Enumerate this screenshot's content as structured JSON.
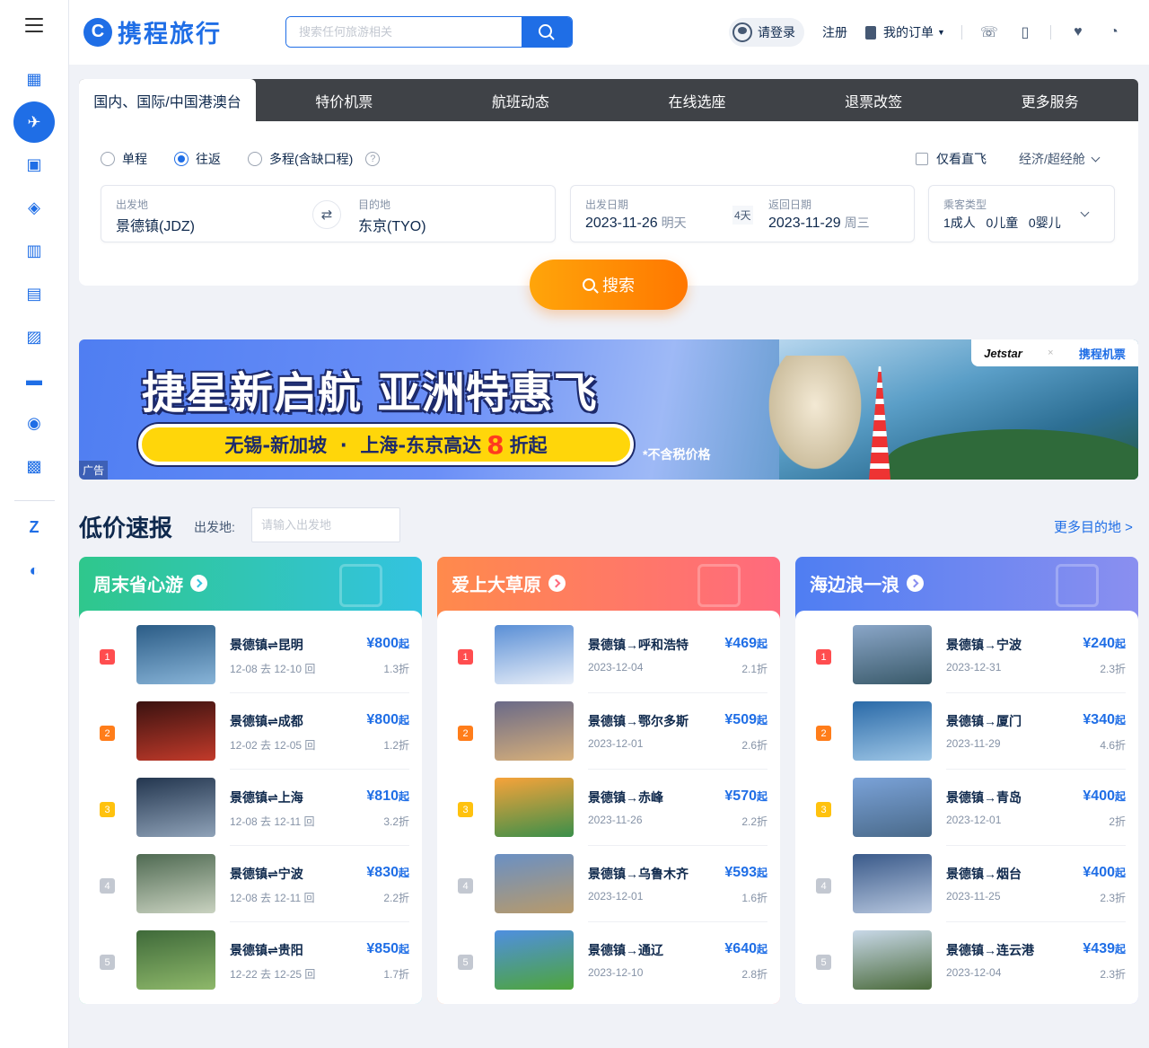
{
  "header": {
    "logo_mark": "C",
    "logo_text": "携程旅行",
    "search_placeholder": "搜索任何旅游相关",
    "login": "请登录",
    "register": "注册",
    "orders": "我的订单"
  },
  "rail": {
    "items": [
      "hotel-icon",
      "plane-icon",
      "train-icon",
      "ticket-icon",
      "guide-icon",
      "bus-icon",
      "photo-icon",
      "car-icon",
      "globe-icon",
      "gift-icon",
      "biz-icon",
      "dolphin-icon"
    ],
    "active": "plane-icon"
  },
  "tabs": [
    "国内、国际/中国港澳台",
    "特价机票",
    "航班动态",
    "在线选座",
    "退票改签",
    "更多服务"
  ],
  "trip": {
    "one_way": "单程",
    "round_trip": "往返",
    "multi": "多程(含缺口程)",
    "help": "?",
    "direct_only": "仅看直飞",
    "cabin": "经济/超经舱"
  },
  "fields": {
    "from_label": "出发地",
    "from_value": "景德镇(JDZ)",
    "to_label": "目的地",
    "to_value": "东京(TYO)",
    "depart_label": "出发日期",
    "depart_value": "2023-11-26",
    "depart_sub": "明天",
    "days": "4天",
    "return_label": "返回日期",
    "return_value": "2023-11-29",
    "return_sub": "周三",
    "pax_label": "乘客类型",
    "pax_value": "1成人   0儿童   0婴儿"
  },
  "search_button": "搜索",
  "banner": {
    "title": "捷星新启航 亚洲特惠飞",
    "pill_prefix": "无锡-新加坡  ·  上海-东京高达",
    "pill_num": "8",
    "pill_suffix": "折起",
    "note": "*不含税价格",
    "ad": "广告",
    "brand_jet": "Jetstar",
    "brand_x": "×",
    "brand_ct": "携程机票"
  },
  "lowprice": {
    "title": "低价速报",
    "from_label": "出发地:",
    "from_placeholder": "请输入出发地",
    "more": "更多目的地 >"
  },
  "columns": [
    {
      "title": "周末省心游",
      "color_from": "#2fc78c",
      "color_to": "#33c3e0",
      "rows": [
        {
          "rank": "1",
          "route": "景德镇⇌昆明",
          "dates": "12-08 去 12-10 回",
          "price": "¥800",
          "suffix": "起",
          "disc": "1.3折"
        },
        {
          "rank": "2",
          "route": "景德镇⇌成都",
          "dates": "12-02 去 12-05 回",
          "price": "¥800",
          "suffix": "起",
          "disc": "1.2折"
        },
        {
          "rank": "3",
          "route": "景德镇⇌上海",
          "dates": "12-08 去 12-11 回",
          "price": "¥810",
          "suffix": "起",
          "disc": "3.2折"
        },
        {
          "rank": "4",
          "route": "景德镇⇌宁波",
          "dates": "12-08 去 12-11 回",
          "price": "¥830",
          "suffix": "起",
          "disc": "2.2折"
        },
        {
          "rank": "5",
          "route": "景德镇⇌贵阳",
          "dates": "12-22 去 12-25 回",
          "price": "¥850",
          "suffix": "起",
          "disc": "1.7折"
        }
      ]
    },
    {
      "title": "爱上大草原",
      "color_from": "#ff8a4c",
      "color_to": "#ff6a7d",
      "rows": [
        {
          "rank": "1",
          "route": "景德镇→呼和浩特",
          "dates": "2023-12-04",
          "price": "¥469",
          "suffix": "起",
          "disc": "2.1折"
        },
        {
          "rank": "2",
          "route": "景德镇→鄂尔多斯",
          "dates": "2023-12-01",
          "price": "¥509",
          "suffix": "起",
          "disc": "2.6折"
        },
        {
          "rank": "3",
          "route": "景德镇→赤峰",
          "dates": "2023-11-26",
          "price": "¥570",
          "suffix": "起",
          "disc": "2.2折"
        },
        {
          "rank": "4",
          "route": "景德镇→乌鲁木齐",
          "dates": "2023-12-01",
          "price": "¥593",
          "suffix": "起",
          "disc": "1.6折"
        },
        {
          "rank": "5",
          "route": "景德镇→通辽",
          "dates": "2023-12-10",
          "price": "¥640",
          "suffix": "起",
          "disc": "2.8折"
        }
      ]
    },
    {
      "title": "海边浪一浪",
      "color_from": "#4f7ef2",
      "color_to": "#8a8ff0",
      "rows": [
        {
          "rank": "1",
          "route": "景德镇→宁波",
          "dates": "2023-12-31",
          "price": "¥240",
          "suffix": "起",
          "disc": "2.3折"
        },
        {
          "rank": "2",
          "route": "景德镇→厦门",
          "dates": "2023-11-29",
          "price": "¥340",
          "suffix": "起",
          "disc": "4.6折"
        },
        {
          "rank": "3",
          "route": "景德镇→青岛",
          "dates": "2023-12-01",
          "price": "¥400",
          "suffix": "起",
          "disc": "2折"
        },
        {
          "rank": "4",
          "route": "景德镇→烟台",
          "dates": "2023-11-25",
          "price": "¥400",
          "suffix": "起",
          "disc": "2.3折"
        },
        {
          "rank": "5",
          "route": "景德镇→连云港",
          "dates": "2023-12-04",
          "price": "¥439",
          "suffix": "起",
          "disc": "2.3折"
        }
      ]
    }
  ],
  "colors": {
    "brand": "#1f6ee6",
    "rank1": "#ff4d4f",
    "rank2": "#ff7d1a",
    "rank3": "#ffc20e",
    "rank_other": "#c3c8d1"
  }
}
